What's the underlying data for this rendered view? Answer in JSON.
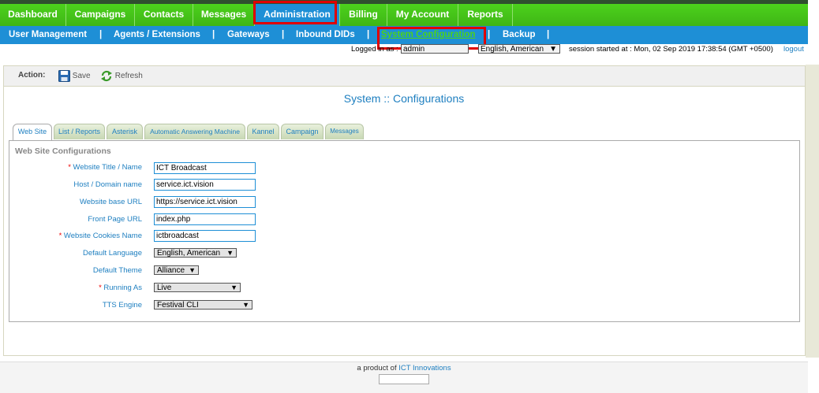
{
  "main_nav": [
    "Dashboard",
    "Campaigns",
    "Contacts",
    "Messages",
    "Administration",
    "Billing",
    "My Account",
    "Reports"
  ],
  "sub_nav": [
    "User Management",
    "Agents / Extensions",
    "Gateways",
    "Inbound DIDs",
    "System Configuration",
    "Backup"
  ],
  "sub_nav_separator": "|",
  "status": {
    "logged_in_label": "Logged in as :",
    "user": "admin",
    "language": "English, American",
    "session": "session started at : Mon, 02 Sep 2019 17:38:54 (GMT +0500)",
    "logout": "logout"
  },
  "action": {
    "label": "Action:",
    "save": "Save",
    "refresh": "Refresh"
  },
  "page_title": "System :: Configurations",
  "tabs": [
    "Web Site",
    "List / Reports",
    "Asterisk",
    "Automatic Answering Machine",
    "Kannel",
    "Campaign",
    "Messages"
  ],
  "section_title": "Web Site Configurations",
  "fields": {
    "website_title": {
      "label": "Website Title / Name",
      "required": "*",
      "value": "ICT Broadcast"
    },
    "host": {
      "label": "Host / Domain name",
      "value": "service.ict.vision"
    },
    "base_url": {
      "label": "Website base URL",
      "value": "https://service.ict.vision"
    },
    "front_page": {
      "label": "Front Page URL",
      "value": "index.php"
    },
    "cookies": {
      "label": "Website Cookies Name",
      "required": "*",
      "value": "ictbroadcast"
    },
    "language": {
      "label": "Default Language",
      "value": "English, American"
    },
    "theme": {
      "label": "Default Theme",
      "value": "Alliance"
    },
    "running_as": {
      "label": "Running As",
      "required": "*",
      "value": "Live"
    },
    "tts": {
      "label": "TTS Engine",
      "value": "Festival CLI"
    }
  },
  "footer": {
    "prefix": "a product of",
    "link": "ICT Innovations"
  },
  "icons": {
    "dropdown": "▼"
  },
  "colors": {
    "green_nav": "#3fb516",
    "blue_nav": "#1e8fd6",
    "highlight": "#e00000",
    "link": "#1e7fc0"
  }
}
